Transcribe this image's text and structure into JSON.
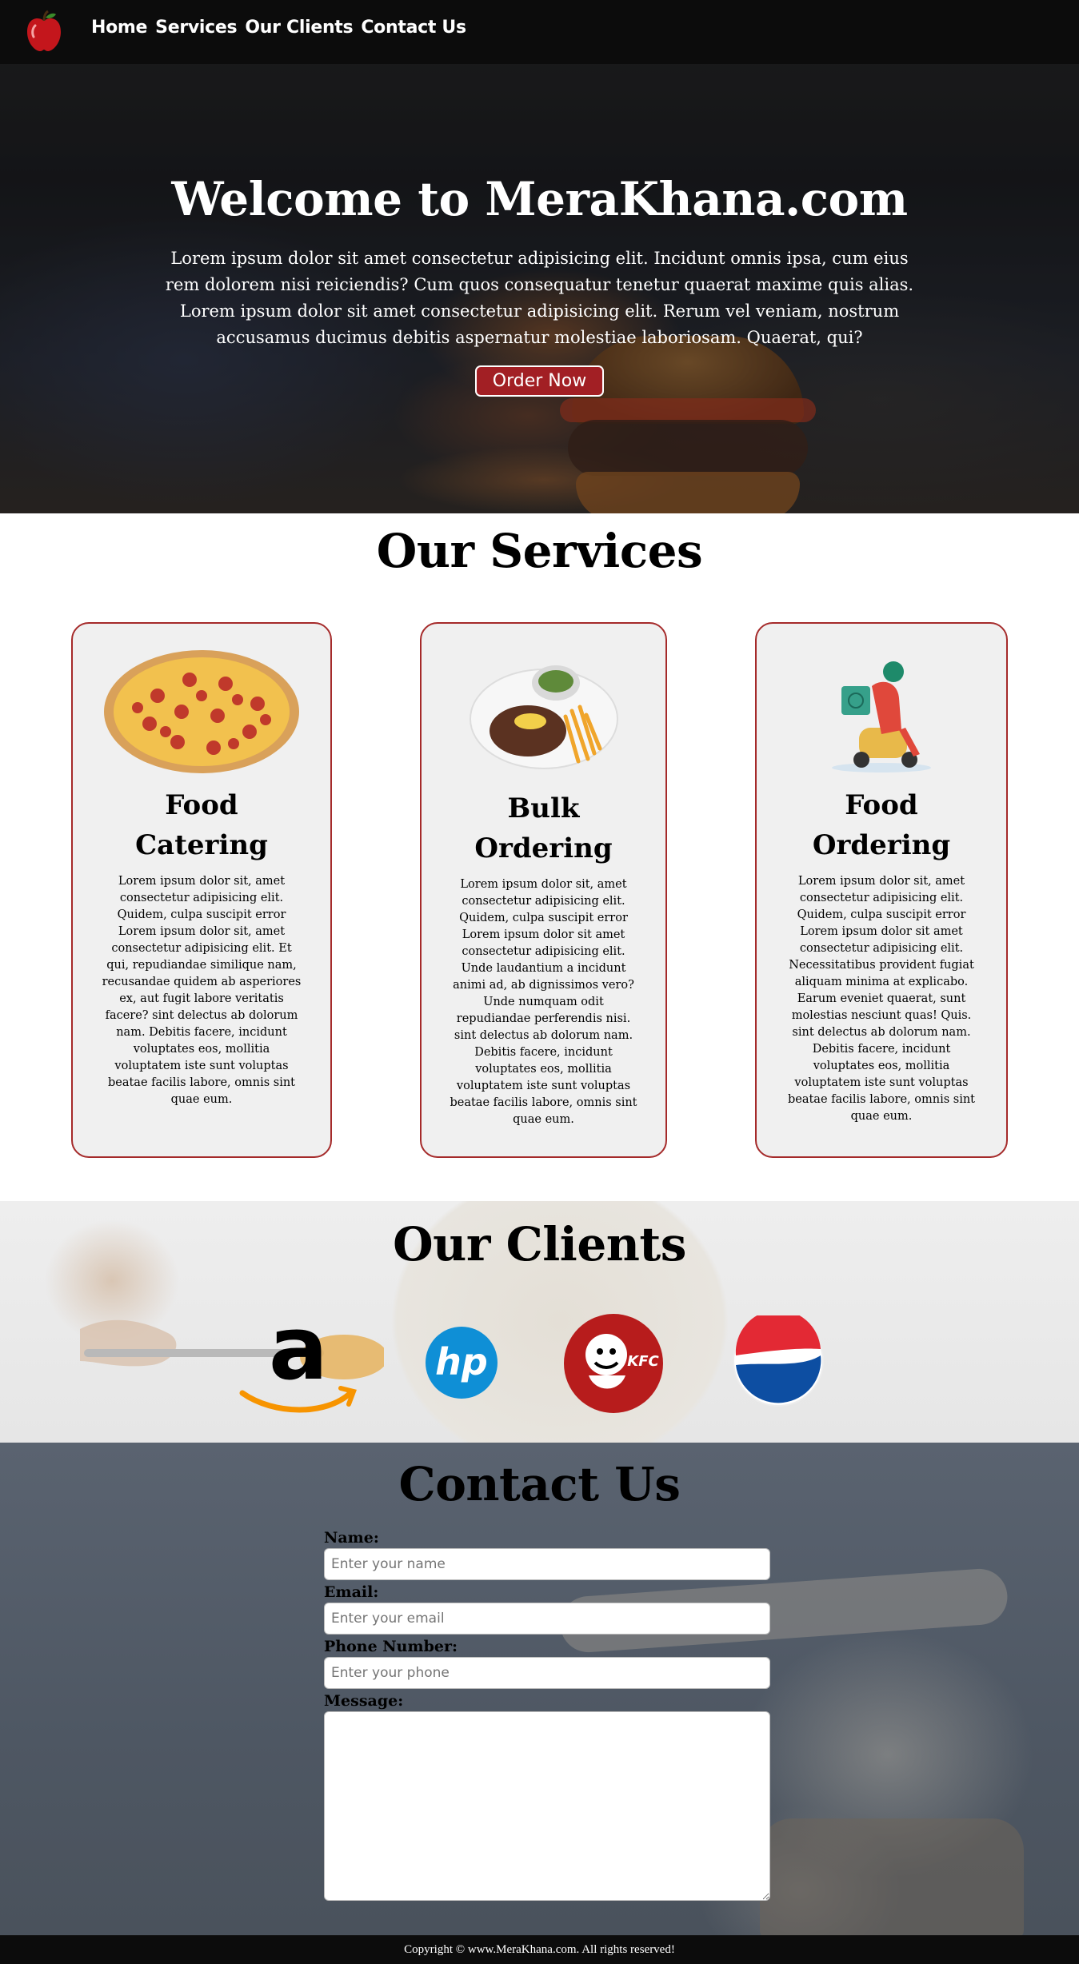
{
  "nav": {
    "links": [
      "Home",
      "Services",
      "Our Clients",
      "Contact Us"
    ]
  },
  "hero": {
    "title": "Welcome to MeraKhana.com",
    "text": "Lorem ipsum dolor sit amet consectetur adipisicing elit. Incidunt omnis ipsa, cum eius rem dolorem nisi reiciendis? Cum quos consequatur tenetur quaerat maxime quis alias. Lorem ipsum dolor sit amet consectetur adipisicing elit. Rerum vel veniam, nostrum accusamus ducimus debitis aspernatur molestiae laboriosam. Quaerat, qui?",
    "button": "Order Now"
  },
  "services": {
    "title": "Our Services",
    "cards": [
      {
        "title": "Food Catering",
        "icon": "pizza-icon",
        "text": "Lorem ipsum dolor sit, amet consectetur adipisicing elit. Quidem, culpa suscipit error Lorem ipsum dolor sit, amet consectetur adipisicing elit. Et qui, repudiandae similique nam, recusandae quidem ab asperiores ex, aut fugit labore veritatis facere? sint delectus ab dolorum nam. Debitis facere, incidunt voluptates eos, mollitia voluptatem iste sunt voluptas beatae facilis labore, omnis sint quae eum."
      },
      {
        "title": "Bulk Ordering",
        "icon": "steak-plate-icon",
        "text": "Lorem ipsum dolor sit, amet consectetur adipisicing elit. Quidem, culpa suscipit error Lorem ipsum dolor sit amet consectetur adipisicing elit. Unde laudantium a incidunt animi ad, ab dignissimos vero? Unde numquam odit repudiandae perferendis nisi. sint delectus ab dolorum nam. Debitis facere, incidunt voluptates eos, mollitia voluptatem iste sunt voluptas beatae facilis labore, omnis sint quae eum."
      },
      {
        "title": "Food Ordering",
        "icon": "delivery-scooter-icon",
        "text": "Lorem ipsum dolor sit, amet consectetur adipisicing elit. Quidem, culpa suscipit error Lorem ipsum dolor sit amet consectetur adipisicing elit. Necessitatibus provident fugiat aliquam minima at explicabo. Earum eveniet quaerat, sunt molestias nesciunt quas! Quis. sint delectus ab dolorum nam. Debitis facere, incidunt voluptates eos, mollitia voluptatem iste sunt voluptas beatae facilis labore, omnis sint quae eum."
      }
    ]
  },
  "clients": {
    "title": "Our Clients",
    "logos": [
      "amazon-logo",
      "hp-logo",
      "kfc-logo",
      "pepsi-logo"
    ],
    "hp_text": "hp",
    "kfc_text": "KFC",
    "amazon_text": "a"
  },
  "contact": {
    "title": "Contact Us",
    "name_label": "Name:",
    "name_placeholder": "Enter your name",
    "email_label": "Email:",
    "email_placeholder": "Enter your email",
    "phone_label": "Phone Number:",
    "phone_placeholder": "Enter your phone",
    "message_label": "Message:"
  },
  "footer": {
    "text": "Copyright © www.MeraKhana.com. All rights reserved!"
  },
  "colors": {
    "accent": "#a52a2a",
    "button": "#a21f24",
    "nav_bg": "#0c0c0c"
  }
}
